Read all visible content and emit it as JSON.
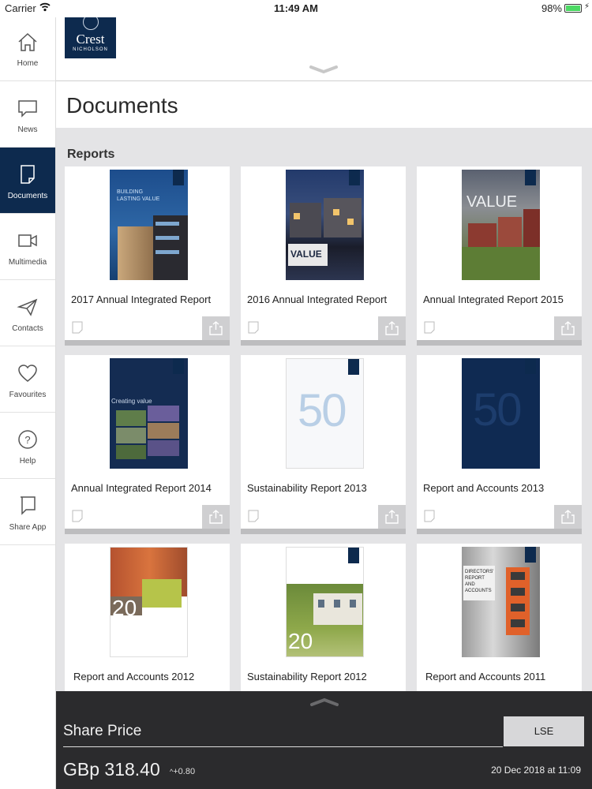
{
  "status_bar": {
    "carrier": "Carrier",
    "time": "11:49 AM",
    "battery": "98%"
  },
  "brand": {
    "name": "Crest",
    "sub": "NICHOLSON"
  },
  "sidebar": {
    "items": [
      {
        "label": "Home",
        "icon": "home-icon"
      },
      {
        "label": "News",
        "icon": "chat-bubble-icon"
      },
      {
        "label": "Documents",
        "icon": "document-icon",
        "active": true
      },
      {
        "label": "Multimedia",
        "icon": "video-camera-icon"
      },
      {
        "label": "Contacts",
        "icon": "paper-plane-icon"
      },
      {
        "label": "Favourites",
        "icon": "heart-icon"
      },
      {
        "label": "Help",
        "icon": "help-circle-icon"
      },
      {
        "label": "Share App",
        "icon": "share-icon"
      }
    ]
  },
  "page": {
    "title": "Documents",
    "section": "Reports"
  },
  "reports": [
    {
      "title": "2017 Annual Integrated Report",
      "cover_text": "BUILDING LASTING VALUE"
    },
    {
      "title": "2016 Annual Integrated Report",
      "cover_text": "VALUE"
    },
    {
      "title": "Annual Integrated Report 2015",
      "cover_text": "VALUE"
    },
    {
      "title": "Annual Integrated Report 2014",
      "cover_text": "Creating value"
    },
    {
      "title": "Sustainability Report 2013",
      "cover_text": "50"
    },
    {
      "title": "Report and Accounts 2013",
      "cover_text": "50"
    },
    {
      "title": "Report and Accounts 2012",
      "cover_text": "20"
    },
    {
      "title": "Sustainability Report 2012",
      "cover_text": "20"
    },
    {
      "title": "Report and Accounts 2011",
      "cover_text": "DIRECTORS' REPORT AND ACCOUNTS"
    }
  ],
  "share_price": {
    "label": "Share Price",
    "exchange": "LSE",
    "price": "GBp 318.40",
    "change": "+0.80",
    "timestamp": "20 Dec 2018 at 11:09"
  },
  "colors": {
    "brand_navy": "#0d2a4e",
    "panel_dark": "#2b2b2d",
    "content_bg": "#e4e4e6"
  }
}
